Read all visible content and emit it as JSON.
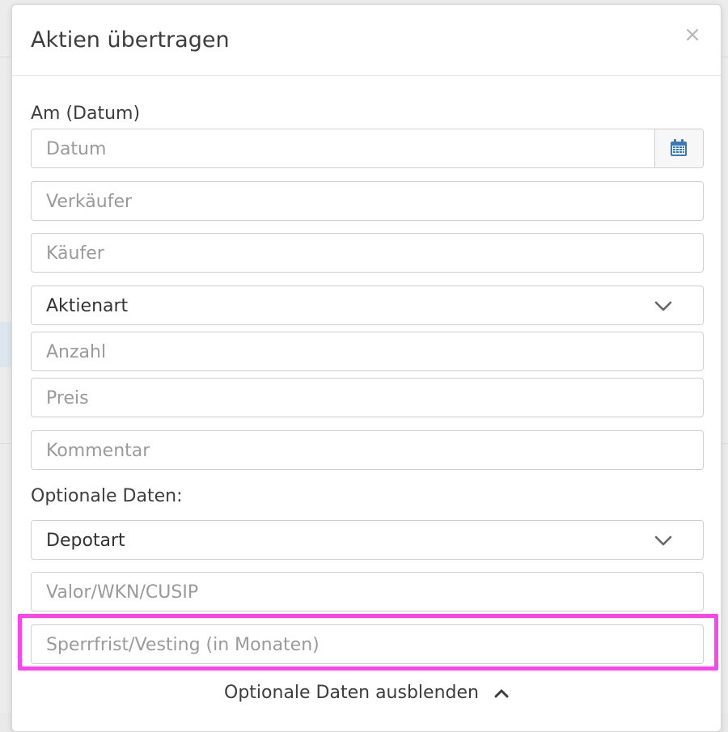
{
  "modal": {
    "title": "Aktien übertragen",
    "close_symbol": "×"
  },
  "form": {
    "date_label": "Am (Datum)",
    "date_placeholder": "Datum",
    "seller_placeholder": "Verkäufer",
    "buyer_placeholder": "Käufer",
    "share_type_value": "Aktienart",
    "quantity_placeholder": "Anzahl",
    "price_placeholder": "Preis",
    "comment_placeholder": "Kommentar",
    "optional_label": "Optionale Daten:",
    "depot_type_value": "Depotart",
    "valor_placeholder": "Valor/WKN/CUSIP",
    "vesting_placeholder": "Sperrfrist/Vesting (in Monaten)",
    "toggle_optional_label": "Optionale Daten ausblenden"
  },
  "icons": {
    "calendar": "calendar-icon",
    "chevron_down": "chevron-down-icon",
    "chevron_up": "chevron-up-icon",
    "close": "close-icon"
  },
  "colors": {
    "highlight": "#ff44ee",
    "calendar_icon": "#3a78b8",
    "text": "#3d3d3d",
    "placeholder": "#9a9a9a"
  }
}
